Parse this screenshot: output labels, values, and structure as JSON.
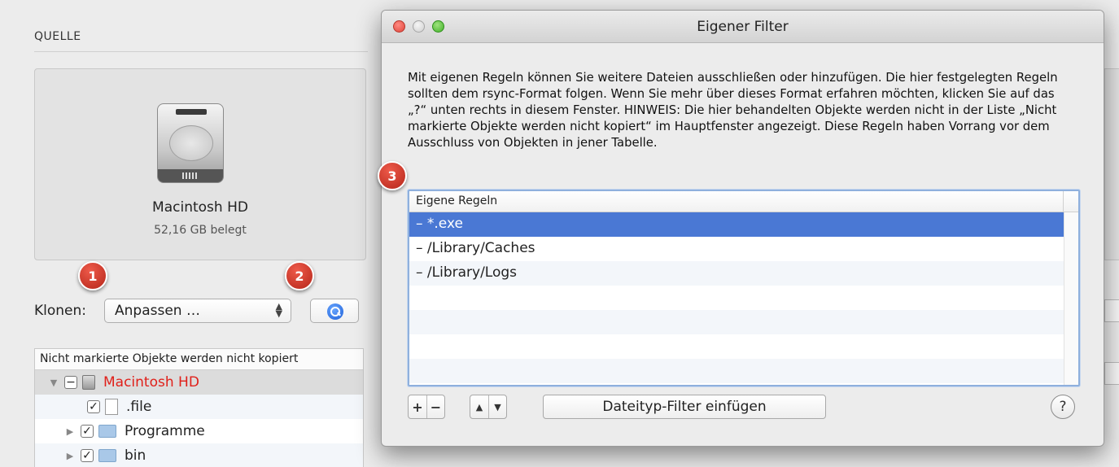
{
  "source": {
    "label": "QUELLE",
    "drive_name": "Macintosh HD",
    "drive_size": "52,16 GB belegt"
  },
  "badges": [
    "1",
    "2",
    "3"
  ],
  "clone": {
    "label": "Klonen:",
    "selected": "Anpassen …"
  },
  "tree": {
    "header": "Nicht markierte Objekte werden nicht kopiert",
    "rows": [
      {
        "label": "Macintosh HD"
      },
      {
        "label": ".file"
      },
      {
        "label": "Programme"
      },
      {
        "label": "bin"
      }
    ]
  },
  "dialog": {
    "title": "Eigener Filter",
    "description": "Mit eigenen Regeln können Sie weitere Dateien ausschließen oder hinzufügen. Die hier festgelegten Regeln sollten dem rsync-Format folgen. Wenn Sie mehr über dieses Format erfahren möchten, klicken Sie auf das „?“ unten rechts in diesem Fenster. HINWEIS: Die hier behandelten Objekte werden nicht in der Liste „Nicht markierte Objekte werden nicht kopiert“ im Hauptfenster angezeigt. Diese Regeln haben Vorrang vor dem Ausschluss von Objekten in jener Tabelle.",
    "rules_header": "Eigene Regeln",
    "rules": [
      "– *.exe",
      "– /Library/Caches",
      "– /Library/Logs"
    ],
    "buttons": {
      "add": "+",
      "remove": "−",
      "up": "▲",
      "down": "▼",
      "insert": "Dateityp-Filter einfügen",
      "help": "?"
    }
  },
  "colors": {
    "selection": "#4a78d4",
    "badge": "#c9301f",
    "excluded_text": "#e0201a"
  }
}
